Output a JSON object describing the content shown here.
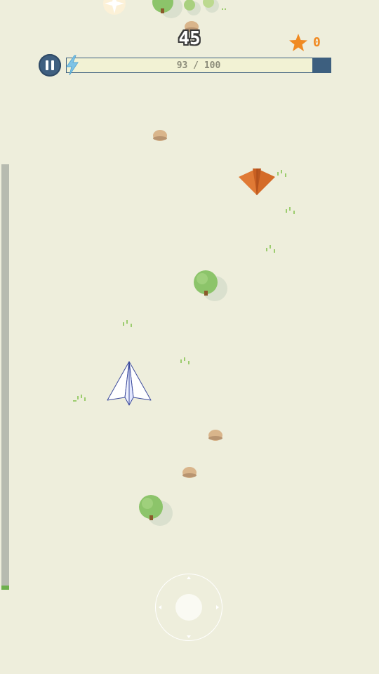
{
  "hud": {
    "score": "45",
    "star_count": "0",
    "energy": {
      "text": "93 / 100",
      "value": 93,
      "max": 100
    },
    "pause_icon": "pause-icon",
    "energy_icon": "lightning-bolt-icon",
    "star_icon": "star-icon"
  },
  "level_progress": {
    "fraction": 0.01
  },
  "colors": {
    "background": "#eeeedc",
    "hud_blue": "#3d5f7f",
    "star_orange": "#f08a22",
    "enemy_orange": "#e07a35",
    "tree_green": "#8cc46a",
    "rock": "#d9b58b"
  },
  "sprites": {
    "player": "white-paper-plane",
    "enemy": "orange-paper-plane",
    "decor": [
      "tree",
      "rock",
      "grass-tuft",
      "sparkle"
    ]
  }
}
